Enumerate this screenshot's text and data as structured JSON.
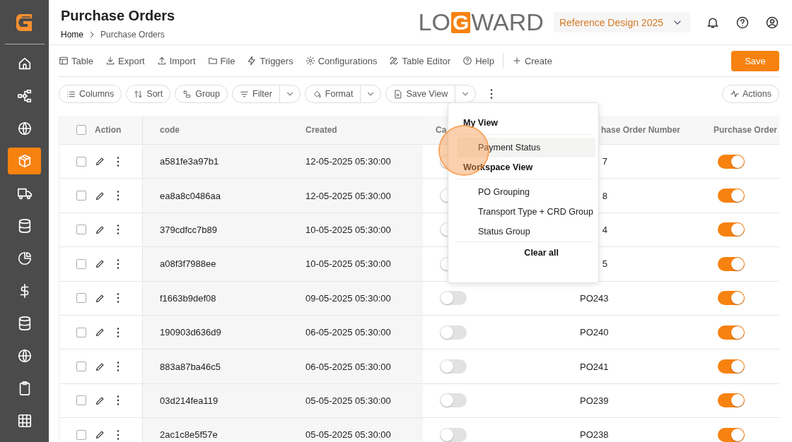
{
  "sidebar": {
    "items": [
      {
        "selected": false
      },
      {
        "selected": false
      },
      {
        "selected": false
      },
      {
        "selected": true
      },
      {
        "selected": false
      },
      {
        "selected": false
      },
      {
        "selected": false
      },
      {
        "selected": false
      },
      {
        "selected": false
      },
      {
        "selected": false
      },
      {
        "selected": false
      },
      {
        "selected": false
      }
    ]
  },
  "header": {
    "title": "Purchase Orders",
    "breadcrumb": [
      "Home",
      "Purchase Orders"
    ],
    "logo": {
      "before": "LO",
      "mark": "G",
      "after": "WARD"
    },
    "workspace": "Reference Design 2025"
  },
  "toolbar": {
    "items": [
      "Table",
      "Export",
      "Import",
      "File",
      "Triggers",
      "Configurations",
      "Table Editor",
      "Help"
    ],
    "create": "Create",
    "save": "Save"
  },
  "view_bar": {
    "buttons": [
      {
        "label": "Columns",
        "split": false
      },
      {
        "label": "Sort",
        "split": false
      },
      {
        "label": "Group",
        "split": false
      },
      {
        "label": "Filter",
        "split": true
      },
      {
        "label": "Format",
        "split": true
      },
      {
        "label": "Save View",
        "split": true
      }
    ],
    "actions": "Actions"
  },
  "table": {
    "header_checked": false,
    "columns": [
      "Action",
      "code",
      "Created",
      "Ca",
      "hase Order Number",
      "Purchase Order"
    ],
    "rows": [
      {
        "checked": false,
        "code": "a581fe3a97b1",
        "created": "12-05-2025 05:30:00",
        "ca_on": false,
        "number": "7",
        "purchase_order_on": true
      },
      {
        "checked": false,
        "code": "ea8a8c0486aa",
        "created": "12-05-2025 05:30:00",
        "ca_on": false,
        "number": "8",
        "purchase_order_on": true
      },
      {
        "checked": false,
        "code": "379cdfcc7b89",
        "created": "10-05-2025 05:30:00",
        "ca_on": false,
        "number": "4",
        "purchase_order_on": true
      },
      {
        "checked": false,
        "code": "a08f3f7988ee",
        "created": "10-05-2025 05:30:00",
        "ca_on": false,
        "number": "5",
        "purchase_order_on": true
      },
      {
        "checked": false,
        "code": "f1663b9def08",
        "created": "09-05-2025 05:30:00",
        "ca_on": false,
        "number": "PO243",
        "purchase_order_on": true
      },
      {
        "checked": false,
        "code": "190903d636d9",
        "created": "06-05-2025 05:30:00",
        "ca_on": false,
        "number": "PO240",
        "purchase_order_on": true
      },
      {
        "checked": false,
        "code": "883a87ba46c5",
        "created": "06-05-2025 05:30:00",
        "ca_on": false,
        "number": "PO241",
        "purchase_order_on": true
      },
      {
        "checked": false,
        "code": "03d214fea119",
        "created": "05-05-2025 05:30:00",
        "ca_on": false,
        "number": "PO239",
        "purchase_order_on": true
      },
      {
        "checked": false,
        "code": "2ac1c8e5f57e",
        "created": "05-05-2025 05:30:00",
        "ca_on": false,
        "number": "PO238",
        "purchase_order_on": true
      }
    ]
  },
  "view_menu": {
    "sections": [
      {
        "title": "My View",
        "items": [
          {
            "label": "Payment Status",
            "selected": true
          }
        ]
      },
      {
        "title": "Workspace View",
        "items": [
          {
            "label": "PO Grouping",
            "selected": false
          },
          {
            "label": "Transport Type + CRD Group",
            "selected": false
          },
          {
            "label": "Status Group",
            "selected": false
          }
        ]
      }
    ],
    "clear": "Clear all"
  }
}
